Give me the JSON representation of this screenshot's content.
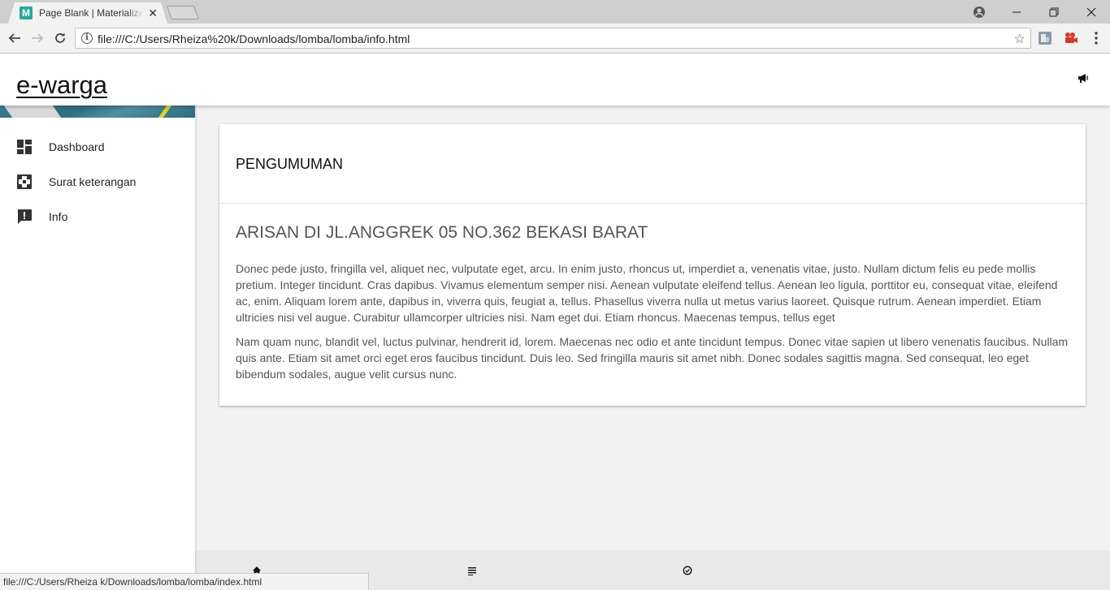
{
  "browser": {
    "tab_title": "Page Blank | Materialize - ",
    "tab_favicon_letter": "M",
    "tab_close": "✕",
    "url": "file:///C:/Users/Rheiza%20k/Downloads/lomba/lomba/info.html",
    "status_url": "file:///C:/Users/Rheiza k/Downloads/lomba/lomba/index.html",
    "icons": [
      "back-arrow-icon",
      "forward-arrow-icon",
      "reload-icon",
      "info-icon",
      "star-icon",
      "account-icon",
      "minimize-icon",
      "restore-icon",
      "close-icon",
      "menu-dots-icon"
    ]
  },
  "app": {
    "brand": "e-warga",
    "header_icon": "megaphone-icon"
  },
  "sidebar": {
    "items": [
      {
        "label": "Dashboard",
        "icon": "dashboard-icon"
      },
      {
        "label": "Surat keterangan",
        "icon": "document-icon"
      },
      {
        "label": "Info",
        "icon": "announcement-icon"
      }
    ]
  },
  "card": {
    "title": "PENGUMUMAN",
    "post_title": "ARISAN DI JL.ANGGREK 05 NO.362 BEKASI BARAT",
    "paragraphs": [
      "Donec pede justo, fringilla vel, aliquet nec, vulputate eget, arcu. In enim justo, rhoncus ut, imperdiet a, venenatis vitae, justo. Nullam dictum felis eu pede mollis pretium. Integer tincidunt. Cras dapibus. Vivamus elementum semper nisi. Aenean vulputate eleifend tellus. Aenean leo ligula, porttitor eu, consequat vitae, eleifend ac, enim. Aliquam lorem ante, dapibus in, viverra quis, feugiat a, tellus. Phasellus viverra nulla ut metus varius laoreet. Quisque rutrum. Aenean imperdiet. Etiam ultricies nisi vel augue. Curabitur ullamcorper ultricies nisi. Nam eget dui. Etiam rhoncus. Maecenas tempus, tellus eget",
      "Nam quam nunc, blandit vel, luctus pulvinar, hendrerit id, lorem. Maecenas nec odio et ante tincidunt tempus. Donec vitae sapien ut libero venenatis faucibus. Nullam quis ante. Etiam sit amet orci eget eros faucibus tincidunt. Duis leo. Sed fringilla mauris sit amet nibh. Donec sodales sagittis magna. Sed consequat, leo eget bibendum sodales, augue velit cursus nunc."
    ]
  },
  "bottom_nav": {
    "icons": [
      "home-icon",
      "list-icon",
      "check-circle-icon"
    ]
  },
  "colors": {
    "favicon": "#26a69a",
    "page_bg": "#f2f2f2",
    "text_muted": "#555555"
  }
}
